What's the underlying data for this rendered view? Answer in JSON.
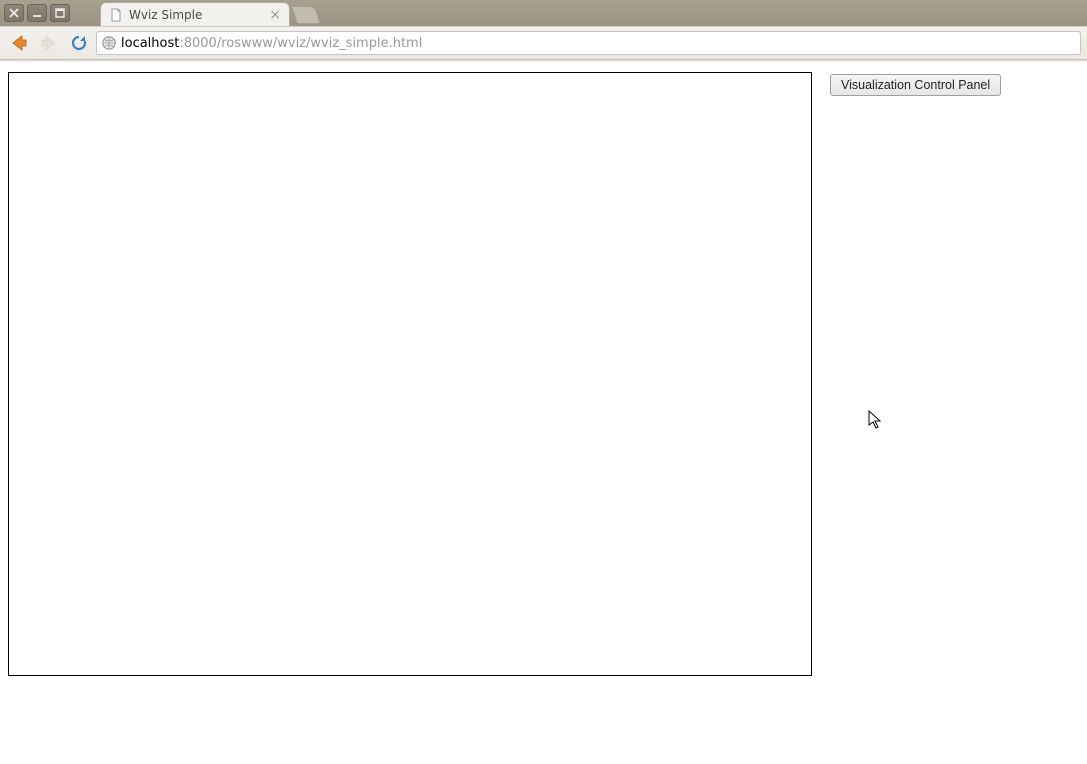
{
  "window": {
    "controls": {
      "close_icon": "close-icon",
      "min_icon": "minimize-icon",
      "max_icon": "maximize-icon"
    }
  },
  "browser": {
    "tab": {
      "title": "Wviz Simple"
    },
    "nav": {
      "back_enabled": true,
      "forward_enabled": false
    },
    "url": {
      "host": "localhost",
      "rest": ":8000/roswww/wviz/wviz_simple.html"
    }
  },
  "page": {
    "control_panel_button": "Visualization Control Panel"
  }
}
